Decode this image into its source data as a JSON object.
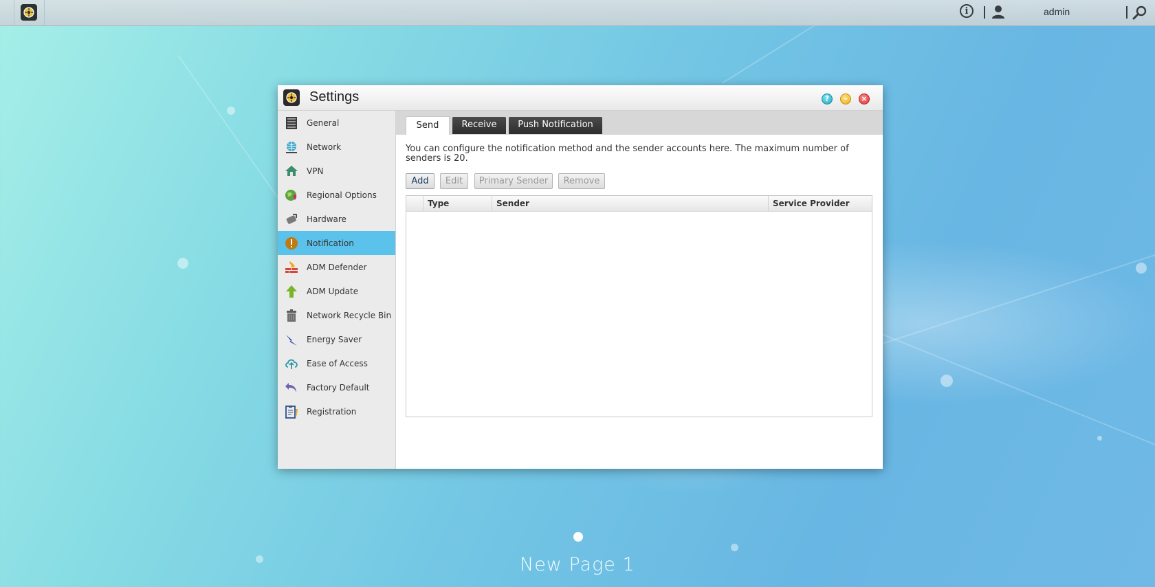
{
  "topbar": {
    "username": "admin"
  },
  "window": {
    "title": "Settings"
  },
  "sidebar": {
    "items": [
      {
        "label": "General",
        "icon": "server-icon"
      },
      {
        "label": "Network",
        "icon": "globe-network-icon"
      },
      {
        "label": "VPN",
        "icon": "vpn-house-icon"
      },
      {
        "label": "Regional Options",
        "icon": "globe-pin-icon"
      },
      {
        "label": "Hardware",
        "icon": "hardware-wrench-icon"
      },
      {
        "label": "Notification",
        "icon": "alert-icon",
        "active": true
      },
      {
        "label": "ADM Defender",
        "icon": "firewall-icon"
      },
      {
        "label": "ADM Update",
        "icon": "up-arrow-icon"
      },
      {
        "label": "Network Recycle Bin",
        "icon": "trash-icon"
      },
      {
        "label": "Energy Saver",
        "icon": "lightning-icon"
      },
      {
        "label": "Ease of Access",
        "icon": "cloud-upload-icon"
      },
      {
        "label": "Factory Default",
        "icon": "undo-arrow-icon"
      },
      {
        "label": "Registration",
        "icon": "clipboard-icon"
      }
    ]
  },
  "tabs": {
    "send": "Send",
    "receive": "Receive",
    "push": "Push Notification"
  },
  "content": {
    "description": "You can configure the notification method and the sender accounts here. The maximum number of senders is 20.",
    "buttons": {
      "add": "Add",
      "edit": "Edit",
      "primary_sender": "Primary Sender",
      "remove": "Remove"
    },
    "table": {
      "columns": [
        "Type",
        "Sender",
        "Service Provider"
      ],
      "rows": []
    }
  },
  "desktop": {
    "page_label": "New Page 1"
  },
  "colors": {
    "active_sidebar": "#5bc3eb",
    "help_button": "#23a6c2",
    "minimize_button": "#e9ae1e",
    "close_button": "#d93434"
  }
}
